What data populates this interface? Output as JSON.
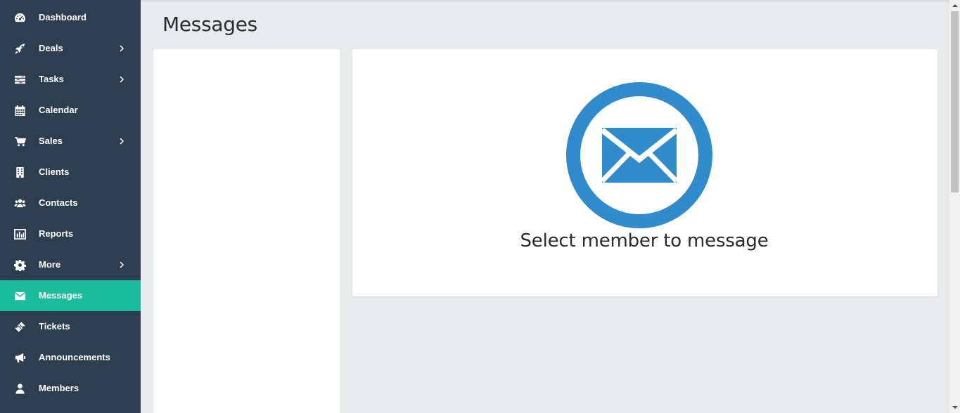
{
  "sidebar": {
    "items": [
      {
        "label": "Dashboard",
        "icon": "dashboard-icon",
        "has_submenu": false,
        "active": false
      },
      {
        "label": "Deals",
        "icon": "rocket-icon",
        "has_submenu": true,
        "active": false
      },
      {
        "label": "Tasks",
        "icon": "tasks-icon",
        "has_submenu": true,
        "active": false
      },
      {
        "label": "Calendar",
        "icon": "calendar-icon",
        "has_submenu": false,
        "active": false
      },
      {
        "label": "Sales",
        "icon": "cart-icon",
        "has_submenu": true,
        "active": false
      },
      {
        "label": "Clients",
        "icon": "building-icon",
        "has_submenu": false,
        "active": false
      },
      {
        "label": "Contacts",
        "icon": "users-icon",
        "has_submenu": false,
        "active": false
      },
      {
        "label": "Reports",
        "icon": "bar-chart-icon",
        "has_submenu": false,
        "active": false
      },
      {
        "label": "More",
        "icon": "gear-icon",
        "has_submenu": true,
        "active": false
      },
      {
        "label": "Messages",
        "icon": "envelope-icon",
        "has_submenu": false,
        "active": true
      },
      {
        "label": "Tickets",
        "icon": "ticket-icon",
        "has_submenu": false,
        "active": false
      },
      {
        "label": "Announcements",
        "icon": "megaphone-icon",
        "has_submenu": false,
        "active": false
      },
      {
        "label": "Members",
        "icon": "user-icon",
        "has_submenu": false,
        "active": false
      }
    ]
  },
  "page": {
    "title": "Messages"
  },
  "message_panel": {
    "empty_text": "Select member to message",
    "icon": "envelope-circle-icon"
  },
  "colors": {
    "sidebar_bg": "#2d3e50",
    "active_item": "#1abc9c",
    "accent_blue": "#2f8bcc",
    "page_bg": "#e8ebee"
  }
}
